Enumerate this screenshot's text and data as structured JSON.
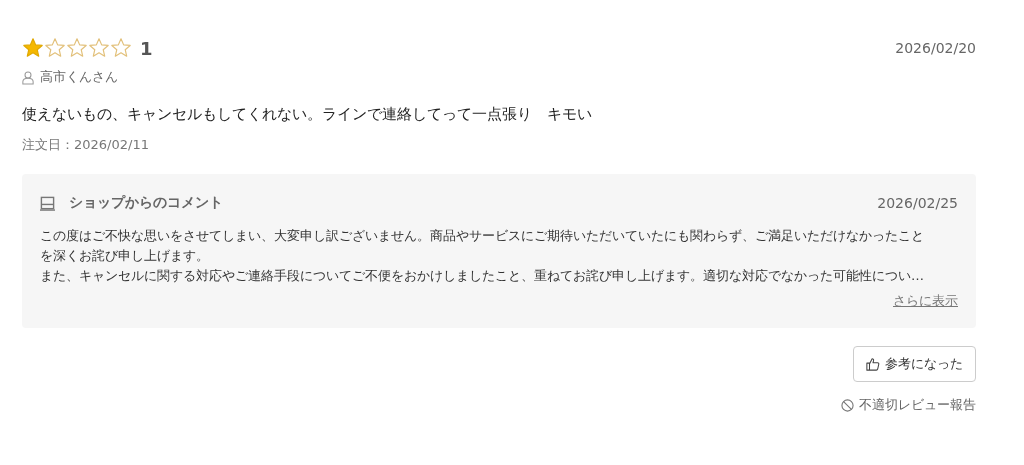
{
  "review": {
    "stars": 1,
    "rating": "1",
    "date": "2026/02/20",
    "reviewer": "高市くんさん",
    "body": "使えないもの、キャンセルもしてくれない。ラインで連絡してって一点張り　キモい",
    "order_date": "注文日：2026/02/11"
  },
  "shop_comment": {
    "title": "ショップからのコメント",
    "date": "2026/02/25",
    "paragraphs": [
      "この度はご不快な思いをさせてしまい、大変申し訳ございません。商品やサービスにご期待いただいていたにも関わらず、ご満足いただけなかったことを深くお詫び申し上げます。",
      "また、キャンセルに関する対応やご連絡手段についてご不便をおかけしましたこと、重ねてお詫び申し上げます。適切な対応でなかった可能性につい…"
    ],
    "more_link": "さらに表示"
  },
  "helpful_button": "参考になった",
  "report_link": "不適切レビュー報告"
}
